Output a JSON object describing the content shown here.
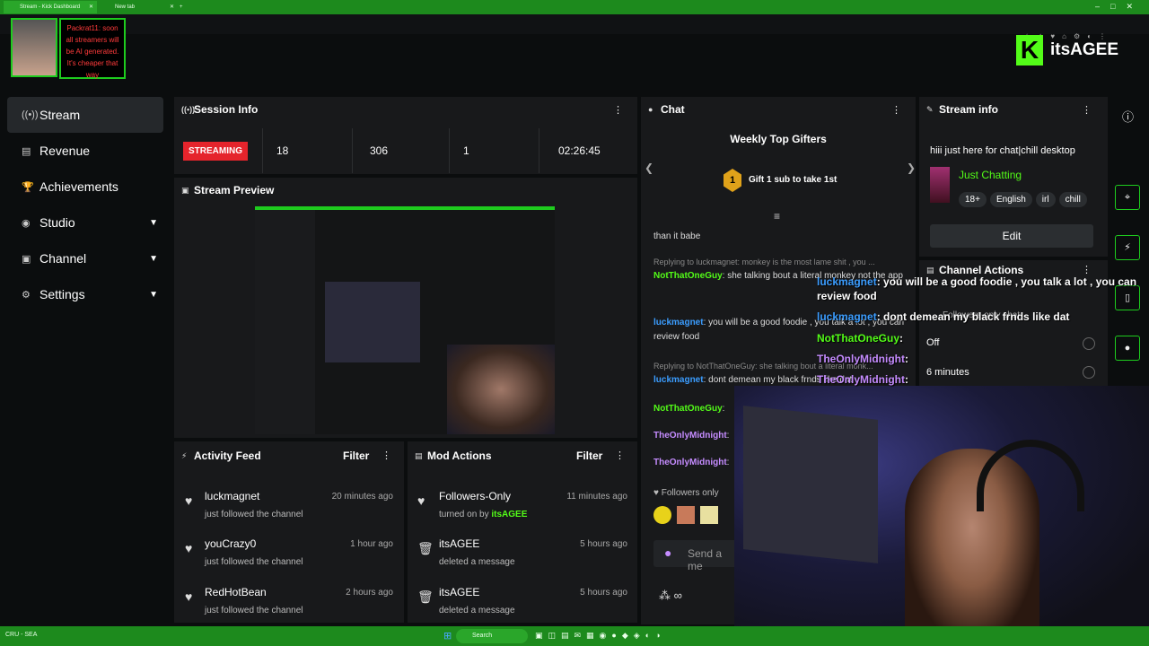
{
  "browser": {
    "tabs": [
      {
        "label": "Stream - Kick Dashboard"
      },
      {
        "label": "New tab"
      }
    ],
    "new_tab": "+"
  },
  "alert": {
    "text": "Packrat11: soon all streamers will be AI generated. It's cheaper that way"
  },
  "brand": {
    "logo_letter": "K",
    "name": "itsAGEE"
  },
  "sidebar": {
    "items": [
      {
        "label": "Stream",
        "icon": "stream-icon",
        "glyph": "((•))"
      },
      {
        "label": "Revenue",
        "icon": "revenue-icon",
        "glyph": "▤"
      },
      {
        "label": "Achievements",
        "icon": "trophy-icon",
        "glyph": "🏆"
      },
      {
        "label": "Studio",
        "icon": "studio-icon",
        "glyph": "◉"
      },
      {
        "label": "Channel",
        "icon": "channel-icon",
        "glyph": "▣"
      },
      {
        "label": "Settings",
        "icon": "gear-icon",
        "glyph": "⚙"
      }
    ]
  },
  "session": {
    "title": "Session Info",
    "status": "STREAMING",
    "stats": [
      "18",
      "306",
      "1",
      "02:26:45"
    ]
  },
  "preview": {
    "title": "Stream Preview"
  },
  "activity": {
    "title": "Activity Feed",
    "filter": "Filter",
    "items": [
      {
        "user": "luckmagnet",
        "action": "just followed the channel",
        "time": "20 minutes ago"
      },
      {
        "user": "youCrazy0",
        "action": "just followed the channel",
        "time": "1 hour ago"
      },
      {
        "user": "RedHotBean",
        "action": "just followed the channel",
        "time": "2 hours ago"
      }
    ]
  },
  "mod": {
    "title": "Mod Actions",
    "filter": "Filter",
    "items": [
      {
        "title": "Followers-Only",
        "desc_prefix": "turned on by",
        "desc_user": "itsAGEE",
        "time": "11 minutes ago"
      },
      {
        "title": "itsAGEE",
        "desc_prefix": "deleted a message",
        "desc_user": "",
        "time": "5 hours ago"
      },
      {
        "title": "itsAGEE",
        "desc_prefix": "deleted a message",
        "desc_user": "",
        "time": "5 hours ago"
      }
    ]
  },
  "chat": {
    "title": "Chat",
    "gifters_title": "Weekly Top Gifters",
    "gifter_rank": "1",
    "gifter_text": "Gift 1 sub to take 1st",
    "lines": [
      {
        "reply": "",
        "user": "",
        "text": "than it babe"
      },
      {
        "reply": "Replying to luckmagnet: monkey is the most lame shit , you ...",
        "user": "NotThatOneGuy",
        "text": ": she talking bout a literal monkey not the app"
      },
      {
        "reply": "",
        "user": "luckmagnet",
        "text": ": you will be a good foodie , you talk a lot , you can review food"
      },
      {
        "reply": "Replying to NotThatOneGuy: she talking bout a literal monk...",
        "user": "luckmagnet",
        "text": ": dont demean my black frnds like dat"
      },
      {
        "reply": "",
        "user": "NotThatOneGuy",
        "text": ":"
      },
      {
        "reply": "",
        "user": "TheOnlyMidnight",
        "text": ":"
      },
      {
        "reply": "",
        "user": "TheOnlyMidnight",
        "text": ":"
      }
    ],
    "followers_only": "Followers only",
    "send_placeholder": "Send a me",
    "infinity": "∞"
  },
  "stream_info": {
    "title": "Stream info",
    "stream_title": "hiii just here for chat|chill desktop",
    "category": "Just Chatting",
    "tags": [
      "18+",
      "English",
      "irl",
      "chill"
    ],
    "edit": "Edit"
  },
  "channel_actions": {
    "title": "Channel Actions",
    "followers_label": "Followers-only chat",
    "off": "Off",
    "minutes": "6 minutes"
  },
  "overlay_chat": [
    {
      "user": "luckmagnet",
      "text": "you will be a good foodie , you talk a lot , you can review food"
    },
    {
      "user": "luckmagnet",
      "text": "dont demean my black frnds like dat"
    },
    {
      "user": "NotThatOneGuy",
      "text": ""
    },
    {
      "user": "TheOnlyMidnight",
      "text": ""
    },
    {
      "user": "TheOnlyMidnight",
      "text": ""
    }
  ],
  "taskbar": {
    "search": "Search",
    "left_text": "CRU - SEA"
  },
  "colors": {
    "accent": "#53fc18",
    "streaming": "#e5242c",
    "panel": "#18191b",
    "background": "#0b0d0e"
  }
}
